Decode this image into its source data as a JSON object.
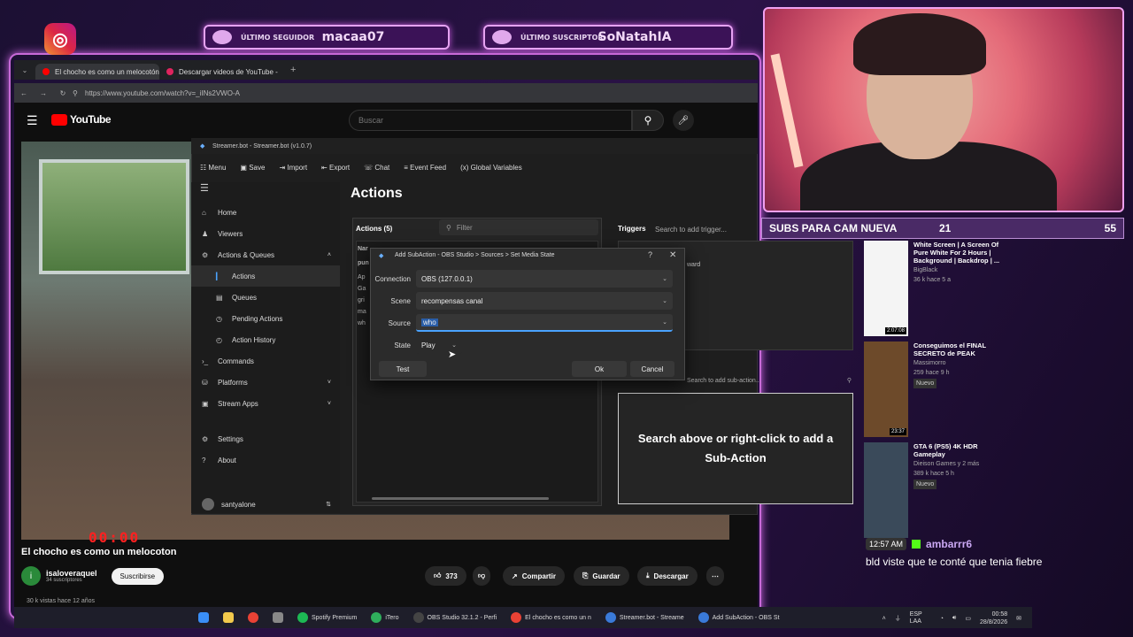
{
  "overlay": {
    "last_follower_tag": "ÚLTIMO SEGUIDOR",
    "last_follower_name": "macaa07",
    "last_subscriber_tag": "ÚLTIMO SUSCRIPTOR",
    "last_subscriber_name": "SoNatahIA",
    "sub_goal_label": "SUBS PARA CAM NUEVA",
    "sub_goal_current": "21",
    "sub_goal_target": "55",
    "sub_goal_progress": 0.38,
    "timer": "00:00"
  },
  "browser": {
    "tabs": [
      {
        "label": "El chocho es como un melocotón"
      },
      {
        "label": "Descargar videos de YouTube -"
      }
    ],
    "url": "https://www.youtube.com/watch?v=_iINs2VWO-A"
  },
  "youtube": {
    "logo": "YouTube",
    "search_placeholder": "Buscar",
    "video_title": "El chocho es como un melocoton",
    "channel": "isaloveraquel",
    "channel_initial": "i",
    "subscribers": "34 suscriptores",
    "subscribe_label": "Suscribirse",
    "likes": "373",
    "share_label": "Compartir",
    "save_label": "Guardar",
    "download_label": "Descargar",
    "views": "30 k vistas  hace 12 años",
    "feed": [
      {
        "title": "White Screen | A Screen Of Pure White For 2 Hours | Background | Backdrop | ...",
        "channel": "BigBlack",
        "meta": "36 k  hace 5 a",
        "duration": "2:07:08",
        "badge": "",
        "color": "#f4f4f4"
      },
      {
        "title": "Conseguimos el FINAL SECRETO de PEAK",
        "channel": "Massimorro",
        "meta": "259  hace 9 h",
        "duration": "23:37",
        "badge": "Nuevo",
        "color": "#6d4a2a"
      },
      {
        "title": "GTA 6 (PS5) 4K HDR Gameplay",
        "channel": "Dieison Games  y 2 más",
        "meta": "389 k  hace 5 h",
        "duration": "",
        "badge": "Nuevo",
        "color": "#3a4a5a"
      }
    ]
  },
  "chat": {
    "time": "12:57 AM",
    "user": "ambarrr6",
    "message": "bld viste que te conté que tenia fiebre"
  },
  "streamerbot": {
    "title": "Streamer.bot - Streamer.bot (v1.0.7)",
    "menu": [
      "Menu",
      "Save",
      "Import",
      "Export",
      "Chat",
      "Event Feed",
      "Global Variables"
    ],
    "nav": [
      {
        "label": "Home",
        "icon": "⌂",
        "sub": false,
        "active": false,
        "chev": ""
      },
      {
        "label": "Viewers",
        "icon": "♟",
        "sub": false,
        "active": false,
        "chev": ""
      },
      {
        "label": "Actions & Queues",
        "icon": "⚙",
        "sub": false,
        "active": false,
        "chev": "˄"
      },
      {
        "label": "Actions",
        "icon": "▎",
        "sub": true,
        "active": true,
        "chev": ""
      },
      {
        "label": "Queues",
        "icon": "▤",
        "sub": true,
        "active": false,
        "chev": ""
      },
      {
        "label": "Pending Actions",
        "icon": "◷",
        "sub": true,
        "active": false,
        "chev": ""
      },
      {
        "label": "Action History",
        "icon": "◴",
        "sub": true,
        "active": false,
        "chev": ""
      },
      {
        "label": "Commands",
        "icon": "›_",
        "sub": false,
        "active": false,
        "chev": ""
      },
      {
        "label": "Platforms",
        "icon": "⛁",
        "sub": false,
        "active": false,
        "chev": "˅"
      },
      {
        "label": "Stream Apps",
        "icon": "▣",
        "sub": false,
        "active": false,
        "chev": "˅"
      },
      {
        "label": "Settings",
        "icon": "⚙",
        "sub": false,
        "active": false,
        "chev": ""
      },
      {
        "label": "About",
        "icon": "?",
        "sub": false,
        "active": false,
        "chev": ""
      }
    ],
    "user": "santyalone",
    "heading": "Actions",
    "actions_label": "Actions (5)",
    "filter_placeholder": "Filter",
    "triggers_label": "Triggers",
    "trigger_search": "Search to add trigger...",
    "subaction_search": "Search to add sub-action...",
    "empty_text": "Search above or right-click to add a Sub-Action",
    "trigger_item": "ward",
    "left_rows": [
      "Nar",
      "pun",
      "Ap",
      "Ga",
      "gri",
      "ma",
      "wh"
    ]
  },
  "dialog": {
    "title": "Add SubAction - OBS Studio > Sources > Set Media State",
    "connection_label": "Connection",
    "connection_value": "OBS (127.0.0.1)",
    "scene_label": "Scene",
    "scene_value": "recompensas canal",
    "source_label": "Source",
    "source_value": "who",
    "state_label": "State",
    "state_value": "Play",
    "test_label": "Test",
    "ok_label": "Ok",
    "cancel_label": "Cancel"
  },
  "taskbar": {
    "apps": [
      "Spotify Premium",
      "iTero",
      "OBS Studio 32.1.2 - Perfi",
      "El chocho es como un n",
      "Streamer.bot - Streame",
      "Add SubAction - OBS St"
    ],
    "lang": "ESP LAA",
    "time": "00:58",
    "date": "28/8/2026"
  }
}
